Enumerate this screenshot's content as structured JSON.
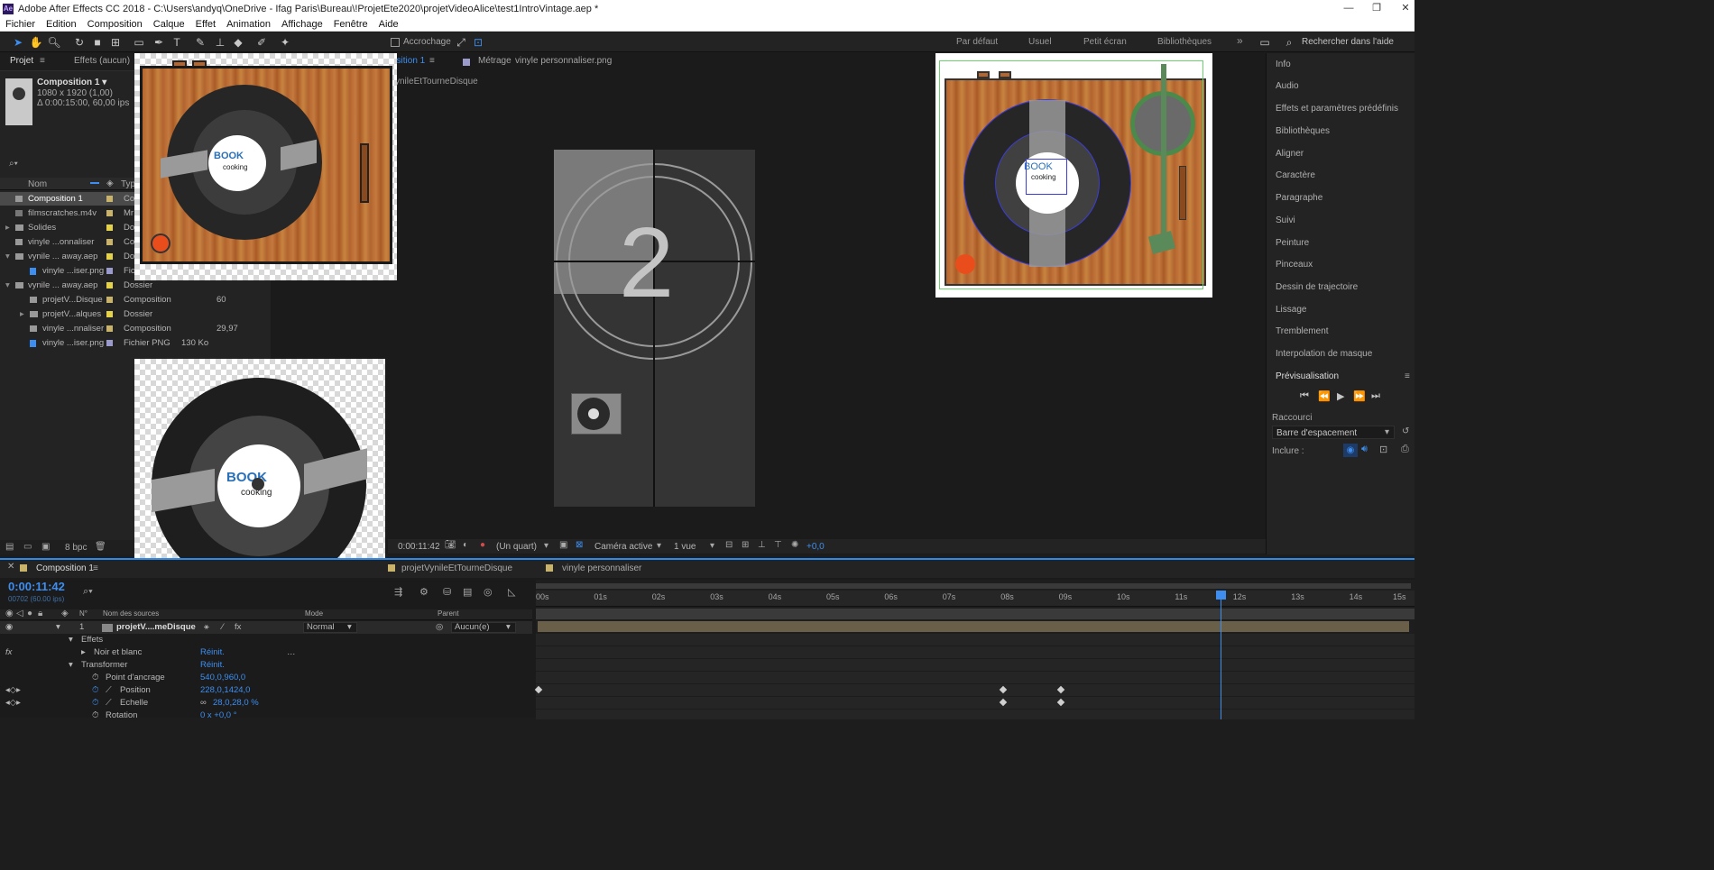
{
  "window": {
    "title": "Adobe After Effects CC 2018 - C:\\Users\\andyq\\OneDrive - Ifag Paris\\Bureau\\!ProjetEte2020\\projetVideoAlice\\test1IntroVintage.aep *",
    "logo": "Ae"
  },
  "menu": [
    "Fichier",
    "Edition",
    "Composition",
    "Calque",
    "Effet",
    "Animation",
    "Affichage",
    "Fenêtre",
    "Aide"
  ],
  "toolbar": {
    "snapping_label": "Accrochage",
    "workspaces": [
      "Par défaut",
      "Usuel",
      "Petit écran",
      "Bibliothèques"
    ],
    "search_placeholder": "Rechercher dans l'aide",
    "more": "»"
  },
  "project": {
    "tab_project": "Projet",
    "tab_effects": "Effets (aucun)",
    "comp_name": "Composition 1 ▾",
    "comp_size": "1080 x 1920 (1,00)",
    "comp_duration": "Δ 0:00:15:00, 60,00 ips",
    "search_icon_text": "⌕▾",
    "col_name": "Nom",
    "col_type": "Type",
    "items": [
      {
        "name": "Composition 1",
        "type": "Co",
        "extra": "",
        "fps": "",
        "color": "#c9b26a",
        "selected": true
      },
      {
        "name": "filmscratches.m4v",
        "type": "Mr",
        "extra": "",
        "fps": "",
        "color": "#c9b26a"
      },
      {
        "name": "Solides",
        "type": "Do",
        "extra": "",
        "fps": "",
        "color": "#e3d24a"
      },
      {
        "name": "vinyle ...onnaliser",
        "type": "Co",
        "extra": "",
        "fps": "",
        "color": "#c9b26a"
      },
      {
        "name": "vynile ... away.aep",
        "type": "Do",
        "extra": "",
        "fps": "",
        "color": "#e3d24a"
      },
      {
        "name": "vinyle ...iser.png",
        "type": "Fic",
        "extra": "",
        "fps": "",
        "color": "#9a9acd"
      },
      {
        "name": "vynile ... away.aep",
        "type": "Dossier",
        "extra": "",
        "fps": "",
        "color": "#e3d24a"
      },
      {
        "name": "projetV...Disque",
        "type": "Composition",
        "extra": "60",
        "fps": "",
        "color": "#c9b26a"
      },
      {
        "name": "projetV...alques",
        "type": "Dossier",
        "extra": "",
        "fps": "",
        "color": "#e3d24a"
      },
      {
        "name": "vinyle ...nnaliser",
        "type": "Composition",
        "extra": "29,97",
        "fps": "",
        "color": "#c9b26a"
      },
      {
        "name": "vinyle ...iser.png",
        "type": "Fichier PNG",
        "extra": "130 Ko",
        "fps": "",
        "color": "#9a9acd"
      }
    ],
    "bpc": "8 bpc"
  },
  "viewer": {
    "tab_comp": "osition 1",
    "tab_footage": "Métrage",
    "footage_name": "vinyle personnaliser.png",
    "breadcrumb": "ynileEtTourneDisque",
    "countdown_number": "2",
    "timecode": "0:00:11:42",
    "resolution": "(Un quart)",
    "camera": "Caméra active",
    "views": "1 vue",
    "exposure": "+0,0"
  },
  "stickers": {
    "label_top": "BOOK",
    "label_bottom": "cooking"
  },
  "right_panel": {
    "items": [
      "Info",
      "Audio",
      "Effets et paramètres prédéfinis",
      "Bibliothèques",
      "Aligner",
      "Caractère",
      "Paragraphe",
      "Suivi",
      "Peinture",
      "Pinceaux",
      "Dessin de trajectoire",
      "Lissage",
      "Tremblement",
      "Interpolation de masque"
    ],
    "preview_title": "Prévisualisation",
    "shortcut_label": "Raccourci",
    "shortcut_value": "Barre d'espacement",
    "include_label": "Inclure :"
  },
  "timeline": {
    "tab_comp": "Composition 1",
    "tab_2": "projetVynileEtTourneDisque",
    "tab_3": "vinyle personnaliser",
    "timecode": "0:00:11:42",
    "frames": "00702 (60.00 ips)",
    "col_source": "Nom des sources",
    "col_mode": "Mode",
    "col_parent": "Parent",
    "layer_num": "1",
    "layer_name": "projetV....meDisque",
    "layer_mode": "Normal",
    "layer_parent": "Aucun(e)",
    "effects_label": "Effets",
    "effect_1": "Noir et blanc",
    "reset": "Réinit.",
    "transform_label": "Transformer",
    "props": [
      {
        "name": "Point d'ancrage",
        "value": "540,0,960,0"
      },
      {
        "name": "Position",
        "value": "228,0,1424,0"
      },
      {
        "name": "Echelle",
        "value": "28,0,28,0 %"
      },
      {
        "name": "Rotation",
        "value": "0 x +0,0 °"
      }
    ],
    "ruler": [
      "00s",
      "01s",
      "02s",
      "03s",
      "04s",
      "05s",
      "06s",
      "07s",
      "08s",
      "09s",
      "10s",
      "11s",
      "12s",
      "13s",
      "14s",
      "15s"
    ],
    "playhead_fraction": 0.7813
  },
  "colors": {
    "accent": "#2d8ceb",
    "panel": "#232323",
    "bg": "#1d1d1d"
  }
}
